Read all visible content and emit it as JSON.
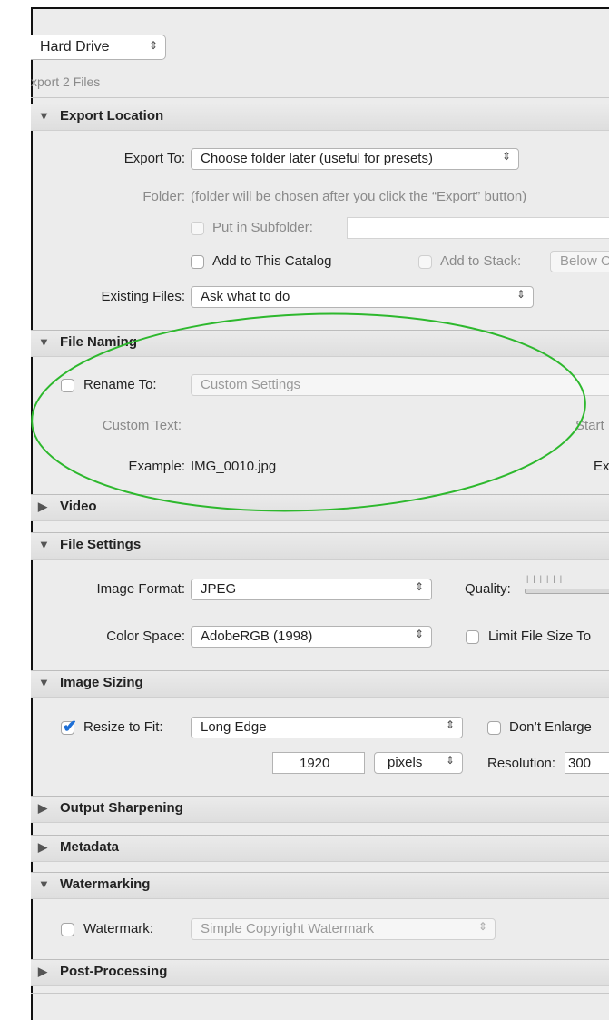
{
  "top": {
    "export_to_select": "Hard Drive",
    "export_count": "xport 2 Files"
  },
  "sections": {
    "export_location": "Export Location",
    "file_naming": "File Naming",
    "video": "Video",
    "file_settings": "File Settings",
    "image_sizing": "Image Sizing",
    "output_sharpening": "Output Sharpening",
    "metadata": "Metadata",
    "watermarking": "Watermarking",
    "post_processing": "Post-Processing"
  },
  "export_location": {
    "export_to_label": "Export To:",
    "export_to_value": "Choose folder later (useful for presets)",
    "folder_label": "Folder:",
    "folder_value": "(folder will be chosen after you click the “Export” button)",
    "subfolder_label": "Put in Subfolder:",
    "subfolder_value": "",
    "add_catalog_label": "Add to This Catalog",
    "add_stack_label": "Add to Stack:",
    "stack_value": "Below O",
    "existing_files_label": "Existing Files:",
    "existing_files_value": "Ask what to do"
  },
  "file_naming": {
    "rename_label": "Rename To:",
    "rename_value": "Custom Settings",
    "custom_text_label": "Custom Text:",
    "start_label": "Start",
    "example_label": "Example:",
    "example_value": "IMG_0010.jpg",
    "ext_label": "Ex"
  },
  "file_settings": {
    "format_label": "Image Format:",
    "format_value": "JPEG",
    "quality_label": "Quality:",
    "color_space_label": "Color Space:",
    "color_space_value": "AdobeRGB (1998)",
    "limit_label": "Limit File Size To"
  },
  "image_sizing": {
    "resize_label": "Resize to Fit:",
    "resize_checked": true,
    "resize_value": "Long Edge",
    "dont_enlarge_label": "Don’t Enlarge",
    "size_value": "1920",
    "unit_value": "pixels",
    "resolution_label": "Resolution:",
    "resolution_value": "300"
  },
  "watermarking": {
    "watermark_label": "Watermark:",
    "watermark_value": "Simple Copyright Watermark"
  },
  "icons": {
    "disclosure_open": "▼",
    "disclosure_closed": "▶",
    "select_chevron": "⇕",
    "checkmark": "✔"
  },
  "colors": {
    "highlight_ellipse": "#2db82d",
    "checkbox_accent": "#1d6fd6"
  }
}
